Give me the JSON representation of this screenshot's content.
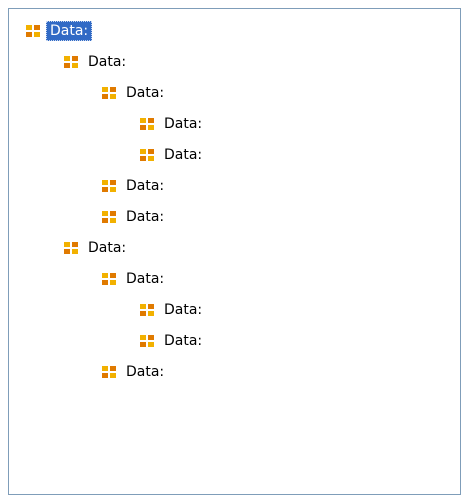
{
  "tree": {
    "nodes": [
      {
        "label": "Data:",
        "level": 0,
        "selected": true
      },
      {
        "label": "Data:",
        "level": 1
      },
      {
        "label": "Data:",
        "level": 2
      },
      {
        "label": "Data:",
        "level": 3
      },
      {
        "label": "Data:",
        "level": 3
      },
      {
        "label": "Data:",
        "level": 2
      },
      {
        "label": "Data:",
        "level": 2
      },
      {
        "label": "Data:",
        "level": 1
      },
      {
        "label": "Data:",
        "level": 2
      },
      {
        "label": "Data:",
        "level": 3
      },
      {
        "label": "Data:",
        "level": 3
      },
      {
        "label": "Data:",
        "level": 2
      }
    ],
    "icon": "table-grid-icon",
    "icon_colors": [
      "#f2b100",
      "#e07a00"
    ],
    "selection_color": "#316ac5"
  }
}
